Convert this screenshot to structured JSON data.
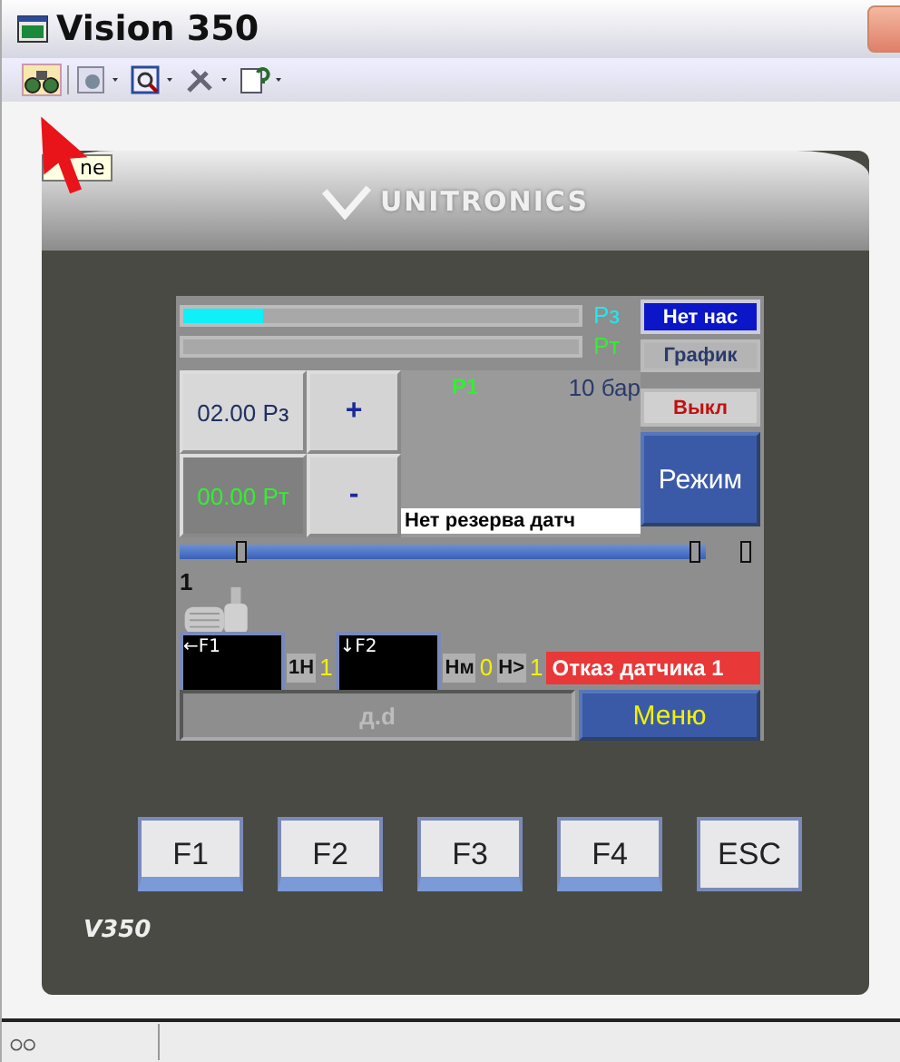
{
  "window": {
    "title": "Vision 350"
  },
  "tooltip": {
    "text": "ne"
  },
  "device": {
    "brand": "UNITRONICS",
    "model": "V350",
    "screen": {
      "bars": [
        {
          "label": "Pз",
          "level": 0.2,
          "color": "#22e8f0"
        },
        {
          "label": "Рт",
          "level": 0,
          "color": "#33ee33"
        }
      ],
      "side_buttons": [
        {
          "label": "Нет нас",
          "kind": "primary"
        },
        {
          "label": "График",
          "kind": "plain"
        },
        {
          "label": "Выкл",
          "kind": "alert"
        },
        {
          "label": "Режим",
          "kind": "big"
        }
      ],
      "setpoints": [
        {
          "value": "02.00 Pз",
          "kind": "normal"
        },
        {
          "value": "00.00 Рт",
          "kind": "live"
        }
      ],
      "adjust_buttons": [
        "+",
        "-"
      ],
      "graph": {
        "series": "P1",
        "scale": "10 бар"
      },
      "message": "Нет резерва датч",
      "range_handles": [
        {
          "level": 0.1
        },
        {
          "level": 0.9
        },
        {
          "level": 0.99
        }
      ],
      "pump": {
        "number": "1"
      },
      "status": [
        {
          "text": "←F1",
          "kind": "key"
        },
        {
          "text": "1Н",
          "kind": "label"
        },
        {
          "text": "1",
          "kind": "value"
        },
        {
          "text": "↓F2",
          "kind": "key"
        },
        {
          "text": "Нм",
          "kind": "label"
        },
        {
          "text": "0",
          "kind": "value"
        },
        {
          "text": "Н>",
          "kind": "label"
        },
        {
          "text": "1",
          "kind": "value"
        },
        {
          "text": "Отказ датчика 1",
          "kind": "alarm"
        }
      ],
      "field": {
        "value": "д.d",
        "disabled": true
      },
      "menu_button": "Меню"
    },
    "keys": [
      {
        "label": "F1",
        "kind": "function"
      },
      {
        "label": "F2",
        "kind": "function"
      },
      {
        "label": "F3",
        "kind": "function"
      },
      {
        "label": "F4",
        "kind": "function"
      },
      {
        "label": "ESC",
        "kind": "plain"
      }
    ]
  }
}
